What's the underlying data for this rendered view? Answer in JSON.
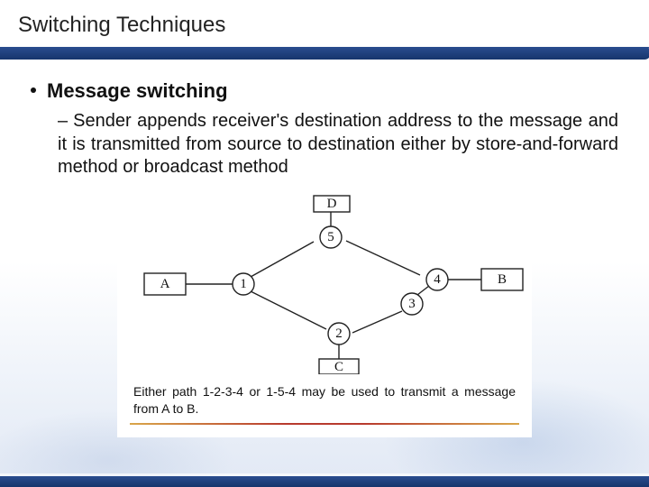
{
  "title": "Switching Techniques",
  "bullet1": "Message switching",
  "bullet2_dash": "–",
  "bullet2": "Sender appends receiver's destination address to the message and it is transmitted from source to destination either by store-and-forward method or broadcast method",
  "diagram": {
    "endpoints": {
      "A": "A",
      "B": "B",
      "C": "C",
      "D": "D"
    },
    "nodes": {
      "n1": "1",
      "n2": "2",
      "n3": "3",
      "n4": "4",
      "n5": "5"
    }
  },
  "caption": "Either path 1-2-3-4 or 1-5-4 may be used to transmit a message from A to B."
}
